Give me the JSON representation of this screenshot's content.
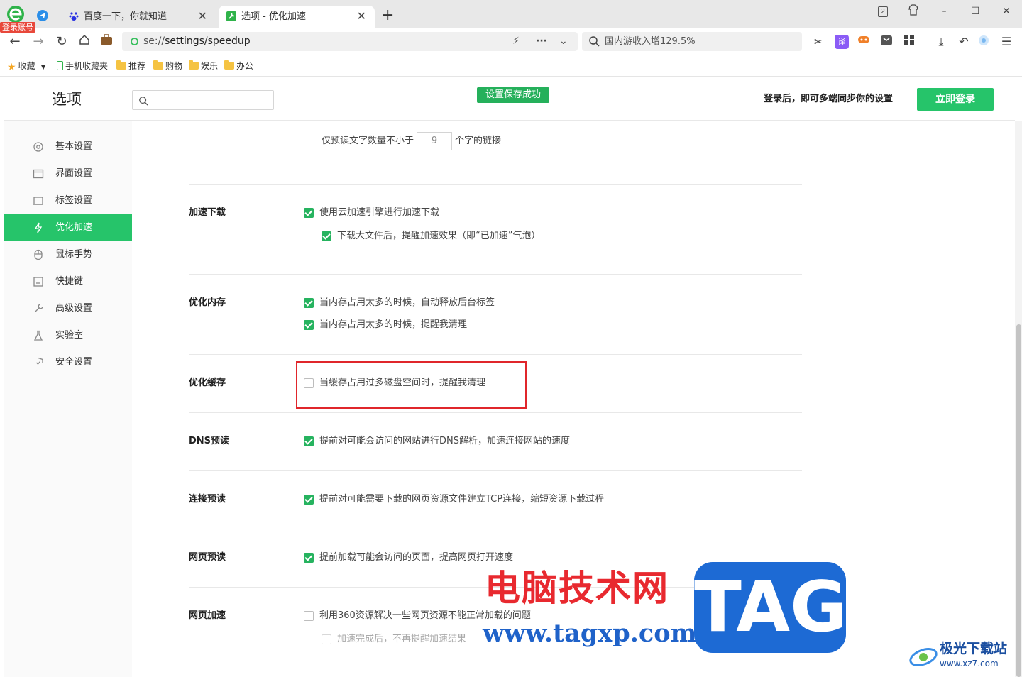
{
  "browser": {
    "login_badge": "登录账号",
    "tabs": [
      {
        "title": "百度一下，你就知道",
        "active": false
      },
      {
        "title": "选项 - 优化加速",
        "active": true
      }
    ],
    "new_tab": "+",
    "tab_count": "2",
    "url_scheme": "se://",
    "url_path": "settings/speedup",
    "search_placeholder": "国内游收入增129.5%",
    "translate_icon_label": "译"
  },
  "bookmarks": {
    "favorites": "收藏",
    "mobile": "手机收藏夹",
    "folders": [
      "推荐",
      "购物",
      "娱乐",
      "办公"
    ]
  },
  "header": {
    "title": "选项",
    "search_value": "",
    "toast": "设置保存成功",
    "sync_text": "登录后，即可多端同步你的设置",
    "login_button": "立即登录"
  },
  "sidebar": {
    "active_index": 3,
    "items": [
      {
        "label": "基本设置",
        "icon": "gear-icon"
      },
      {
        "label": "界面设置",
        "icon": "window-icon"
      },
      {
        "label": "标签设置",
        "icon": "tab-icon"
      },
      {
        "label": "优化加速",
        "icon": "lightning-icon"
      },
      {
        "label": "鼠标手势",
        "icon": "mouse-icon"
      },
      {
        "label": "快捷键",
        "icon": "keyboard-icon"
      },
      {
        "label": "高级设置",
        "icon": "wrench-icon"
      },
      {
        "label": "实验室",
        "icon": "flask-icon"
      },
      {
        "label": "安全设置",
        "icon": "shield-icon"
      }
    ]
  },
  "content": {
    "preread": {
      "prefix": "仅预读文字数量不小于",
      "value": "9",
      "suffix": "个字的链接"
    },
    "sections": [
      {
        "title": "加速下载",
        "options": [
          {
            "label": "使用云加速引擎进行加速下载",
            "checked": true
          },
          {
            "label": "下载大文件后，提醒加速效果（即“已加速”气泡）",
            "checked": true
          }
        ]
      },
      {
        "title": "优化内存",
        "options": [
          {
            "label": "当内存占用太多的时候，自动释放后台标签",
            "checked": true
          },
          {
            "label": "当内存占用太多的时候，提醒我清理",
            "checked": true
          }
        ]
      },
      {
        "title": "优化缓存",
        "options": [
          {
            "label": "当缓存占用过多磁盘空间时，提醒我清理",
            "checked": false
          }
        ]
      },
      {
        "title": "DNS预读",
        "options": [
          {
            "label": "提前对可能会访问的网站进行DNS解析，加速连接网站的速度",
            "checked": true
          }
        ]
      },
      {
        "title": "连接预读",
        "options": [
          {
            "label": "提前对可能需要下载的网页资源文件建立TCP连接，缩短资源下载过程",
            "checked": true
          }
        ]
      },
      {
        "title": "网页预读",
        "options": [
          {
            "label": "提前加载可能会访问的页面，提高网页打开速度",
            "checked": true
          }
        ]
      },
      {
        "title": "网页加速",
        "options": [
          {
            "label": "利用360资源解决一些网页资源不能正常加载的问题",
            "checked": false
          },
          {
            "label": "加速完成后，不再提醒加速结果",
            "checked": false,
            "disabled": true
          }
        ]
      }
    ]
  },
  "watermark": {
    "site_name": "电脑技术网",
    "site_url": "www.tagxp.com",
    "tag": "TAG",
    "brand": "极光下载站",
    "brand_url": "www.xz7.com"
  },
  "colors": {
    "accent_green": "#26c46a",
    "checkbox_green": "#26b35f",
    "highlight_red": "#e0262b"
  }
}
